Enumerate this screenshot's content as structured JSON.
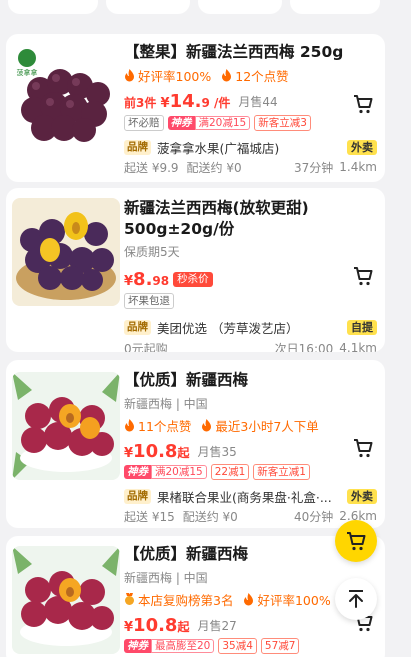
{
  "colors": {
    "accent_red": "#ff3b2f",
    "accent_orange": "#ff6a00",
    "delivery_yellow": "#ffe14d",
    "fab_yellow": "#ffd600"
  },
  "cards": [
    {
      "title": "【整果】新疆法兰西西梅 250g",
      "tags": [
        "好评率100%",
        "12个点赞"
      ],
      "price_prefix": "前3件",
      "price_yen": "¥",
      "price_int": "14.",
      "price_dec": "9",
      "price_unit": "/件",
      "sold": "月售44",
      "pills": [
        "坏必赔"
      ],
      "shen_label": "神券",
      "shen_text": "满20减15",
      "extra_pills": [
        "新客立减3"
      ],
      "brand_label": "品牌",
      "store": "菠拿拿水果(广福城店)",
      "delivery": "外卖",
      "start_fee": "起送 ¥9.9",
      "delivery_fee": "配送约 ¥0",
      "time": "37分钟",
      "distance": "1.4km",
      "logo_text": "菠拿拿",
      "cart_icon": "cart-icon"
    },
    {
      "title": "新疆法兰西西梅(放软更甜) 500g±20g/份",
      "subtitle": "保质期5天",
      "price_yen": "¥",
      "price_int": "8.",
      "price_dec": "98",
      "seckill": "秒杀价",
      "pills": [
        "坏果包退"
      ],
      "brand_label": "品牌",
      "store": "美团优选 （芳草泼艺店）",
      "delivery": "自提",
      "start_fee": "0元起购",
      "time": "次日16:00",
      "distance": "4.1km"
    },
    {
      "title": "【优质】新疆西梅",
      "origin": "新疆西梅 | 中国",
      "tags": [
        "11个点赞",
        "最近3小时7人下单"
      ],
      "price_yen": "¥",
      "price_int": "10.8",
      "price_suffix": "起",
      "sold": "月售35",
      "shen_label": "神券",
      "shen_text": "满20减15",
      "extra_pills": [
        "22减1",
        "新客立减1"
      ],
      "brand_label": "品牌",
      "store": "果楮联合果业(商务果盘·礼盒·...",
      "delivery": "外卖",
      "start_fee": "起送 ¥15",
      "delivery_fee": "配送约 ¥0",
      "time": "40分钟",
      "distance": "2.6km"
    },
    {
      "title": "【优质】新疆西梅",
      "origin": "新疆西梅 | 中国",
      "tags": [
        "本店复购榜第3名",
        "好评率100%"
      ],
      "price_yen": "¥",
      "price_int": "10.8",
      "price_suffix": "起",
      "sold": "月售27",
      "shen_label": "神券",
      "shen_text": "最高膨至20",
      "extra_pills": [
        "35减4",
        "57减7"
      ]
    }
  ]
}
